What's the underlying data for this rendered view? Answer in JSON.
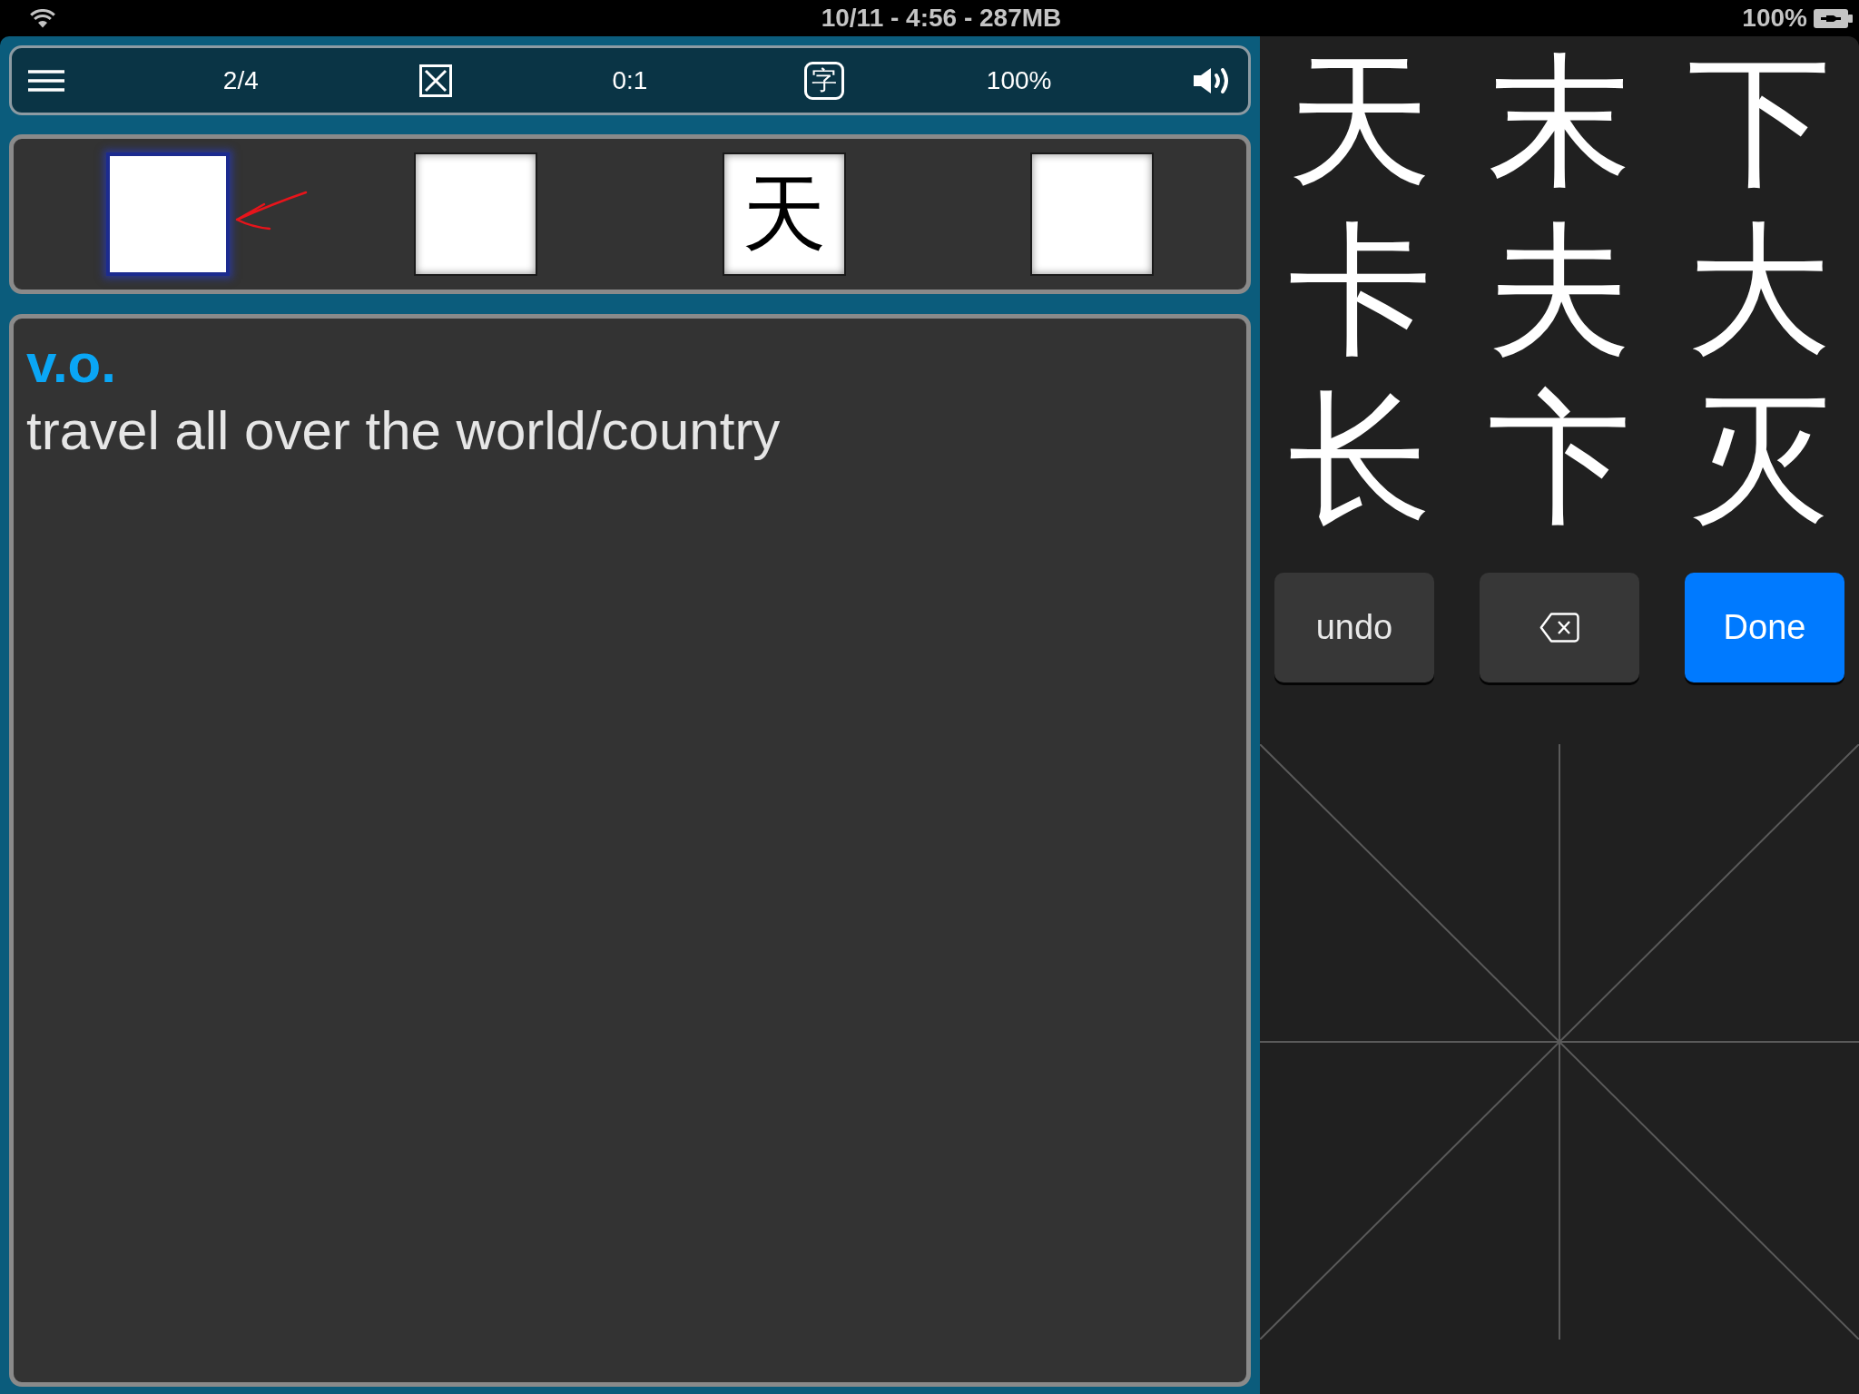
{
  "status_bar": {
    "text": "10/11 - 4:56 - 287MB",
    "battery": "100%"
  },
  "toolbar": [
    {
      "kind": "menu"
    },
    {
      "kind": "counter",
      "text": "2/4"
    },
    {
      "kind": "cross"
    },
    {
      "kind": "score",
      "text": "0:1"
    },
    {
      "kind": "glyph",
      "text": "字"
    },
    {
      "kind": "percent",
      "text": "100%"
    },
    {
      "kind": "speaker"
    }
  ],
  "tiles": [
    {
      "selected": true
    },
    {
      "selected": false
    },
    {
      "character": "天",
      "selected": false
    },
    {
      "selected": false
    }
  ],
  "definition": {
    "part_of_speech": "v.o.",
    "meaning": "travel all over the world/country"
  },
  "candidates": [
    "天",
    "末",
    "下",
    "卡",
    "夫",
    "大",
    "长",
    "卞",
    "灭"
  ],
  "buttons": [
    {
      "kind": "text",
      "label": "undo"
    },
    {
      "kind": "backspace"
    },
    {
      "kind": "primary",
      "label": "Done"
    }
  ]
}
